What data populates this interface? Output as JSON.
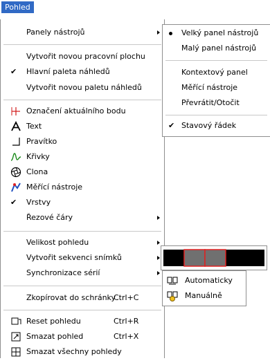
{
  "menubar": {
    "title": "Pohled"
  },
  "main_menu": {
    "panely": "Panely nástrojů",
    "vytvorit_plochu": "Vytvořit novou pracovní plochu",
    "hlavni_paleta": "Hlavní paleta náhledů",
    "nova_paleta": "Vytvořit novou paletu náhledů",
    "oznaceni": "Označení aktuálního bodu",
    "text": "Text",
    "pravitko": "Pravítko",
    "krivky": "Křivky",
    "clona": "Clona",
    "merici": "Měřící nástroje",
    "vrstvy": "Vrstvy",
    "rezove": "Řezové čáry",
    "velikost": "Velikost pohledu",
    "sekvence": "Vytvořit sekvenci snímků",
    "synchronizace": "Synchronizace sérií",
    "zkopirovat": "Zkopírovat do schránky",
    "zkopirovat_shortcut": "Ctrl+C",
    "reset": "Reset pohledu",
    "reset_shortcut": "Ctrl+R",
    "smazat": "Smazat pohled",
    "smazat_shortcut": "Ctrl+X",
    "smazat_vse": "Smazat všechny pohledy"
  },
  "panely_submenu": {
    "velky": "Velký panel nástrojů",
    "maly": "Malý panel nástrojů",
    "kontextovy": "Kontextový panel",
    "merici": "Měřící nástroje",
    "prevratit": "Převrátit/Otočit",
    "stavovy": "Stavový řádek"
  },
  "sync_submenu": {
    "automaticky": "Automaticky",
    "manualne": "Manuálně"
  },
  "checkmark": "✔",
  "colors": {
    "highlight": "#316ac5",
    "seq_black": "#000000",
    "seq_gray": "#707070",
    "seq_red": "#e02020"
  }
}
